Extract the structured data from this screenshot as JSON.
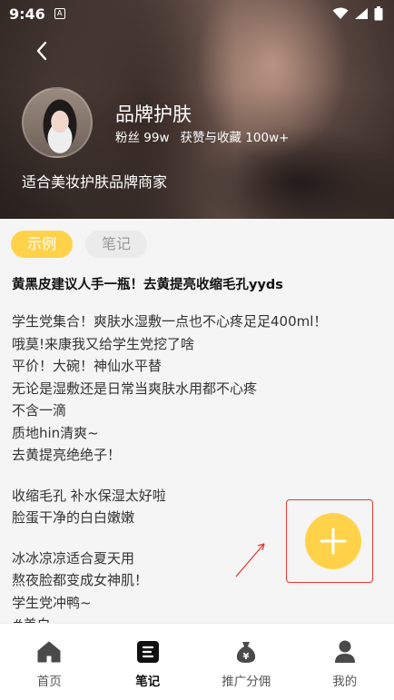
{
  "status_bar": {
    "time": "9:46",
    "notif_glyph": "A"
  },
  "profile": {
    "name": "品牌护肤",
    "fans": "粉丝 99w",
    "likes": "获赞与收藏 100w+",
    "description": "适合美妆护肤品牌商家"
  },
  "tabs": [
    {
      "label": "示例",
      "active": true
    },
    {
      "label": "笔记",
      "active": false
    }
  ],
  "post": {
    "title": "黄黑皮建议人手一瓶！去黄提亮收缩毛孔yyds",
    "paragraphs": [
      [
        "学生党集合！爽肤水湿敷一点也不心疼足足400ml！",
        "哦莫!来康我又给学生党挖了啥",
        "平价！大碗！神仙水平替",
        "无论是湿敷还是日常当爽肤水用都不心疼",
        "不含一滴",
        "质地hin清爽~",
        "去黄提亮绝绝子！"
      ],
      [
        "收缩毛孔 补水保湿太好啦",
        "脸蛋干净的白白嫩嫩"
      ],
      [
        "冰冰凉凉适合夏天用",
        "熬夜脸都变成女神肌！",
        "学生党冲鸭~",
        "#美白"
      ]
    ]
  },
  "nav": [
    {
      "label": "首页",
      "icon": "home-icon",
      "active": false
    },
    {
      "label": "笔记",
      "icon": "notes-icon",
      "active": true
    },
    {
      "label": "推广分佣",
      "icon": "money-bag-icon",
      "active": false
    },
    {
      "label": "我的",
      "icon": "user-icon",
      "active": false
    }
  ],
  "colors": {
    "accent": "#ffd24a",
    "highlight": "#e53935"
  }
}
